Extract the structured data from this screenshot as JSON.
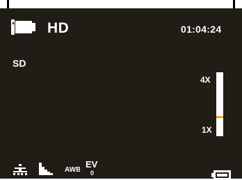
{
  "top_bar": {
    "mode_icon": "video-camera-icon",
    "resolution": "HD",
    "timer": "01:04:24"
  },
  "storage": {
    "label": "SD"
  },
  "zoom": {
    "max_label": "4X",
    "min_label": "1X",
    "level_fraction": 0.3
  },
  "bottom_bar": {
    "icons": [
      "metering-icon",
      "histogram-icon",
      "awb-icon",
      "ev-icon",
      "battery-icon"
    ],
    "awb_text": "AWB",
    "ev_text": "EV",
    "ev_value": "0"
  },
  "colors": {
    "screen_bg": "#201c16",
    "text": "#ffffff",
    "zoom_marker": "#f2a91a"
  }
}
